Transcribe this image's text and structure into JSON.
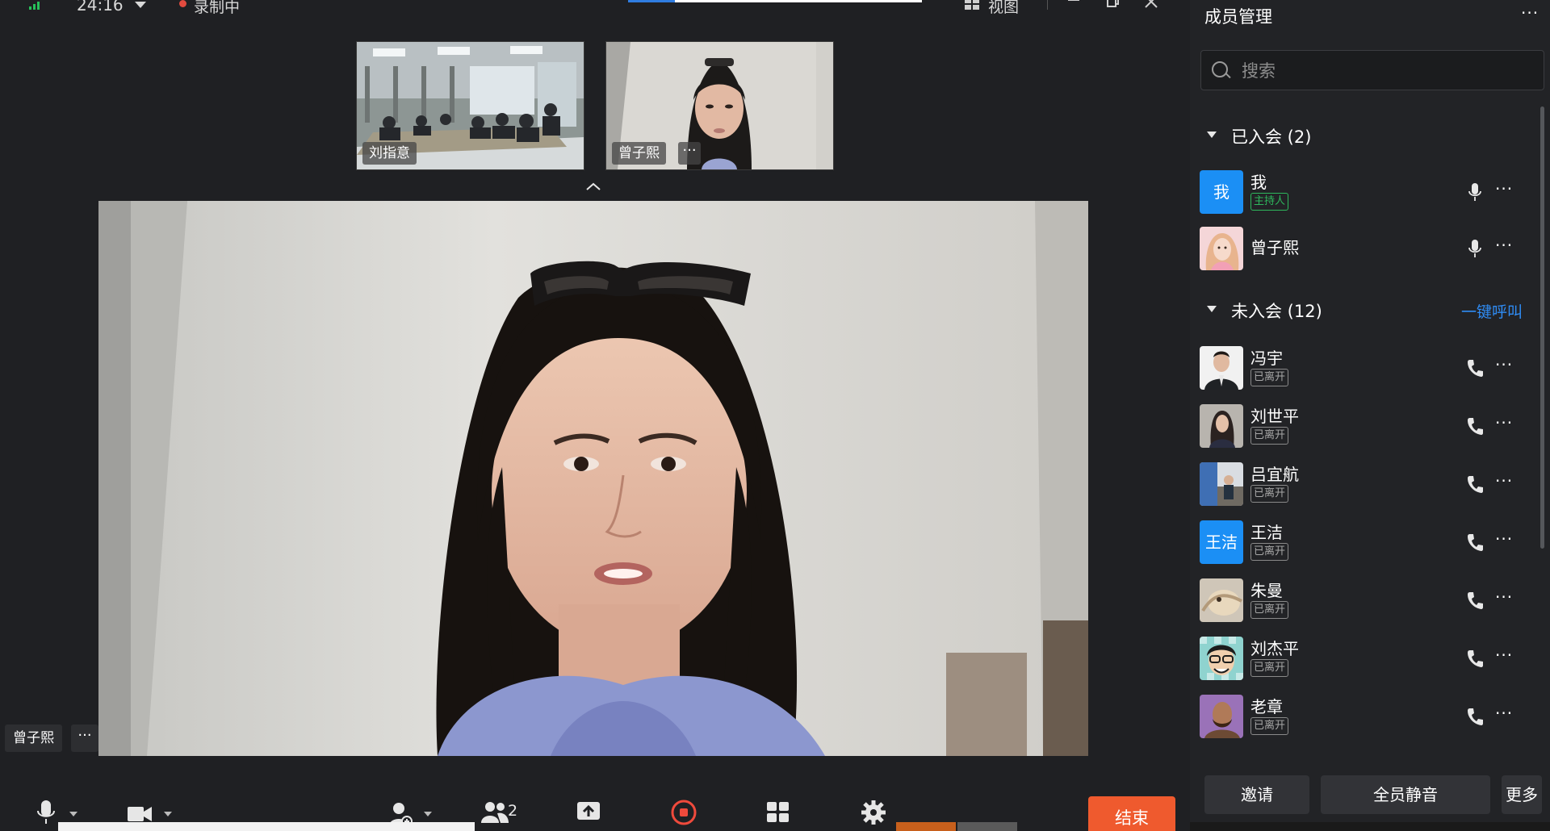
{
  "topbar": {
    "timer": "24:16",
    "recording_label": "录制中",
    "recording_progress": 0.16,
    "view_label": "视图"
  },
  "thumbnails": [
    {
      "name": "刘指意"
    },
    {
      "name": "曾子熙",
      "more": "···"
    }
  ],
  "main_video": {
    "speaker": "曾子熙",
    "more": "···"
  },
  "toolbar": {
    "participants_count": "2",
    "end_label": "结束"
  },
  "colors": {
    "accent": "#2f8cf5",
    "end": "#ef5a2e",
    "host": "#2eb85c",
    "recording": "#e24b3f"
  },
  "panel": {
    "title": "成员管理",
    "menu": "···",
    "search_placeholder": "搜索",
    "joined_label": "已入会 (2)",
    "not_joined_label": "未入会 (12)",
    "call_all": "一键呼叫",
    "joined": [
      {
        "name": "我",
        "avatar_text": "我",
        "badge": "主持人",
        "host": true,
        "icon": "mic-icon"
      },
      {
        "name": "曾子熙",
        "avatar": "photo-pink",
        "icon": "mic-icon"
      }
    ],
    "not_joined": [
      {
        "name": "冯宇",
        "badge": "已离开",
        "avatar": "photo-suit",
        "icon": "phone-icon"
      },
      {
        "name": "刘世平",
        "badge": "已离开",
        "avatar": "photo-portrait",
        "icon": "phone-icon"
      },
      {
        "name": "吕宜航",
        "badge": "已离开",
        "avatar": "photo-scene",
        "icon": "phone-icon"
      },
      {
        "name": "王洁",
        "badge": "已离开",
        "avatar_text": "王洁",
        "icon": "phone-icon"
      },
      {
        "name": "朱曼",
        "badge": "已离开",
        "avatar": "photo-cat",
        "icon": "phone-icon"
      },
      {
        "name": "刘杰平",
        "badge": "已离开",
        "avatar": "cartoon-face",
        "icon": "phone-icon"
      },
      {
        "name": "老章",
        "badge": "已离开",
        "avatar": "photo-man",
        "icon": "phone-icon"
      }
    ],
    "buttons": {
      "invite": "邀请",
      "mute_all": "全员静音",
      "more": "更多"
    }
  }
}
